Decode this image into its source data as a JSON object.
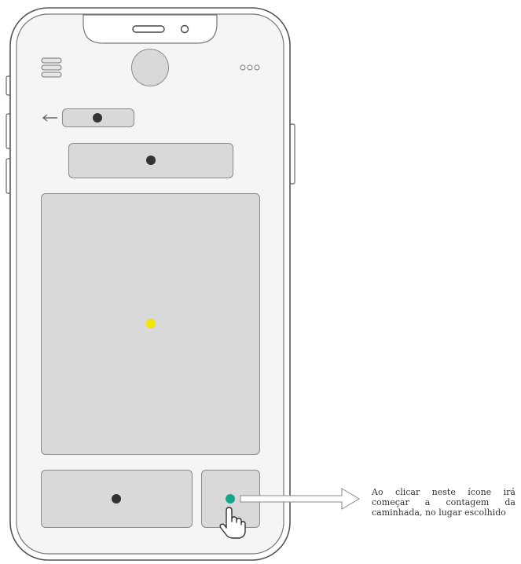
{
  "screen": {
    "frame_color": "#555555",
    "screen_bg": "#f5f5f5",
    "placeholder_fill": "#d9d9d9",
    "accent_dot_color": "#f2e600",
    "action_dot_color": "#17a589",
    "marker_dot_color": "#333333"
  },
  "header": {
    "menu_icon": "hamburger-icon",
    "avatar": "avatar-circle",
    "more_icon": "more-options-icon"
  },
  "nav": {
    "back_icon": "back-arrow-icon"
  },
  "gesture": {
    "icon": "tap-hand-icon"
  },
  "annotation": {
    "text": "Ao clicar neste ícone irá começar a contagem da caminhada, no lugar escolhido"
  }
}
